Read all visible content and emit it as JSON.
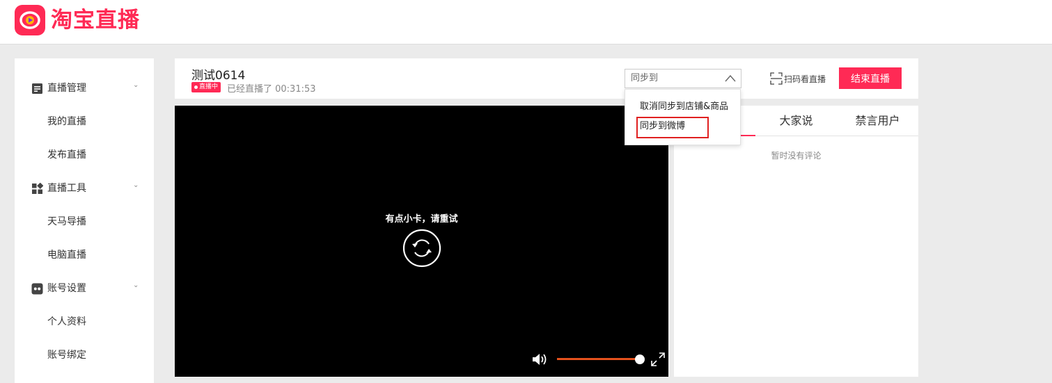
{
  "brand": {
    "name": "淘宝直播",
    "accent": "#ff2a55"
  },
  "sidebar": {
    "groups": [
      {
        "label": "直播管理",
        "icon": "document-icon",
        "items": [
          "我的直播",
          "发布直播"
        ]
      },
      {
        "label": "直播工具",
        "icon": "apps-icon",
        "items": [
          "天马导播",
          "电脑直播"
        ]
      },
      {
        "label": "账号设置",
        "icon": "account-icon",
        "items": [
          "个人资料",
          "账号绑定"
        ]
      }
    ]
  },
  "stream": {
    "title": "测试0614",
    "status_badge": "直播中",
    "elapsed": "已经直播了 00:31:53"
  },
  "sync": {
    "selected": "同步到",
    "options": [
      "取消同步到店铺&商品",
      "同步到微博"
    ],
    "highlighted_option": "同步到微博"
  },
  "scan_label": "扫码看直播",
  "end_button": "结束直播",
  "player": {
    "message": "有点小卡，请重试",
    "volume_percent": 100,
    "volume_color": "#e5521d"
  },
  "chat": {
    "tabs": [
      "",
      "大家说",
      "禁言用户"
    ],
    "empty_text": "暂时没有评论"
  }
}
